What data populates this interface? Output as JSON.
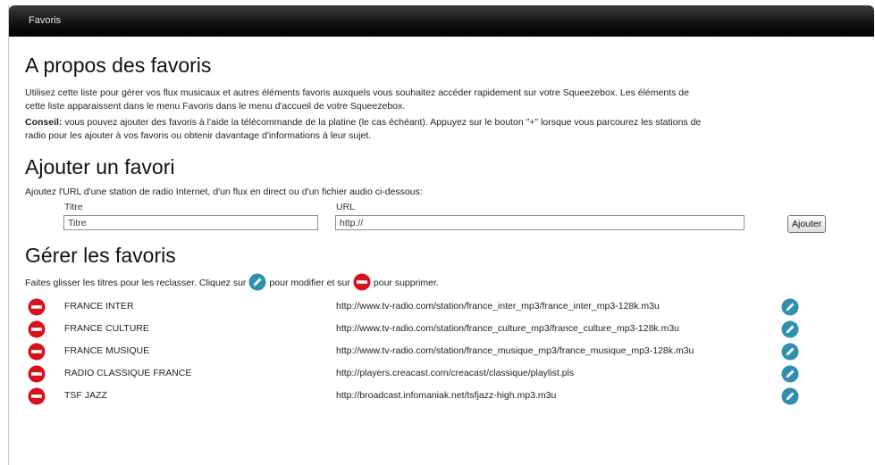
{
  "window": {
    "title": "Favoris"
  },
  "about": {
    "heading": "A propos des favoris",
    "paragraph1": "Utilisez cette liste pour gérer vos flux musicaux et autres éléments favoris auxquels vous souhaitez accéder rapidement sur votre Squeezebox. Les éléments de",
    "paragraph1b": "cette liste apparaissent dans le menu Favoris dans le menu d'accueil de votre Squeezebox.",
    "tip_label": "Conseil:",
    "tip_text": " vous pouvez ajouter des favoris à l'aide la télécommande de la platine (le cas échéant). Appuyez sur le bouton \"+\" lorsque vous parcourez les stations de",
    "tip_text2": "radio pour les ajouter à vos favoris ou obtenir davantage d'informations à leur sujet."
  },
  "add": {
    "heading": "Ajouter un favori",
    "instructions": "Ajoutez l'URL d'une station de radio Internet, d'un flux en direct ou d'un fichier audio ci-dessous:",
    "title_label": "Titre",
    "title_value": "Titre",
    "url_label": "URL",
    "url_value": "http://",
    "add_button": "Ajouter"
  },
  "manage": {
    "heading": "Gérer les favoris",
    "hint_before": "Faites glisser les titres pour les reclasser. Cliquez sur",
    "hint_middle": "pour modifier et sur",
    "hint_after": "pour supprimer.",
    "items": [
      {
        "name": "FRANCE INTER",
        "url": "http://www.tv-radio.com/station/france_inter_mp3/france_inter_mp3-128k.m3u"
      },
      {
        "name": "FRANCE CULTURE",
        "url": "http://www.tv-radio.com/station/france_culture_mp3/france_culture_mp3-128k.m3u"
      },
      {
        "name": "FRANCE MUSIQUE",
        "url": "http://www.tv-radio.com/station/france_musique_mp3/france_musique_mp3-128k.m3u"
      },
      {
        "name": "RADIO CLASSIQUE FRANCE",
        "url": "http://players.creacast.com/creacast/classique/playlist.pls"
      },
      {
        "name": "TSF JAZZ",
        "url": "http://broadcast.infomaniak.net/tsfjazz-high.mp3.m3u"
      }
    ]
  },
  "colors": {
    "delete_icon": "#d8121b",
    "edit_icon": "#2f8fb0",
    "titlebar": "#111111"
  }
}
